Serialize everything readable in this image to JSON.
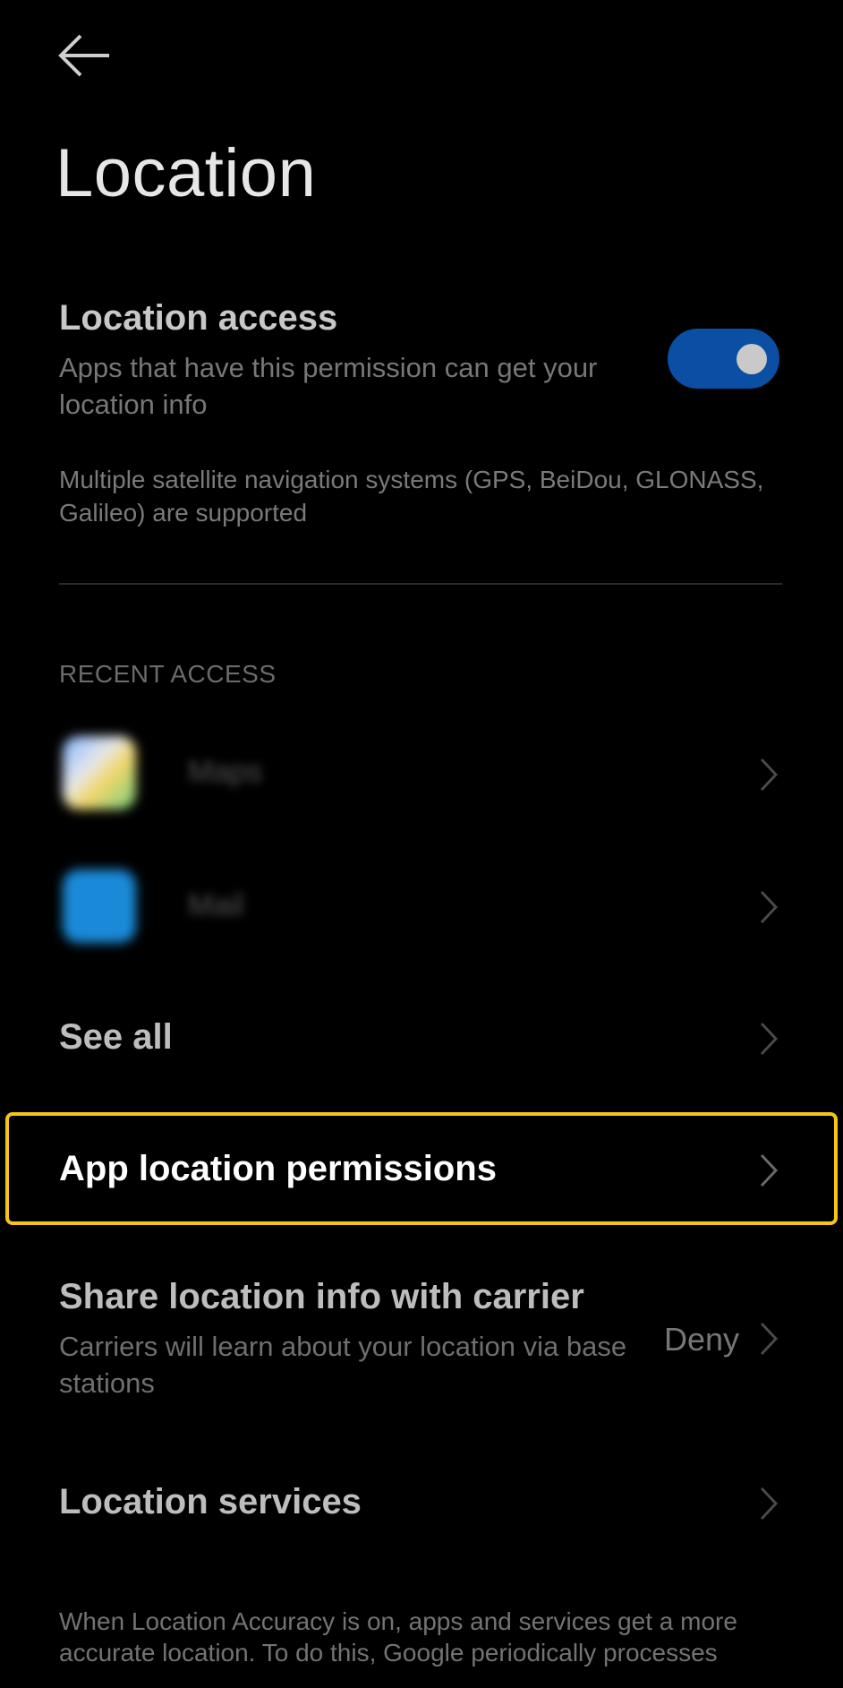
{
  "header": {
    "title": "Location"
  },
  "location_access": {
    "title": "Location access",
    "description": "Apps that have this permission can get your location info",
    "enabled": true,
    "gnss_note": "Multiple satellite navigation systems (GPS, BeiDou, GLONASS, Galileo) are supported"
  },
  "recent_access": {
    "heading": "RECENT ACCESS",
    "apps": [
      {
        "name": "Maps",
        "icon": "maps-app-icon"
      },
      {
        "name": "Mail",
        "icon": "mail-app-icon"
      }
    ]
  },
  "menu": {
    "see_all": "See all",
    "app_permissions": "App location permissions",
    "share_carrier": {
      "title": "Share location info with carrier",
      "description": "Carriers will learn about your location via base stations",
      "value": "Deny"
    },
    "location_services": "Location services"
  },
  "footer": {
    "text": "When Location Accuracy is on, apps and services get a more accurate location. To do this, Google periodically processes"
  },
  "colors": {
    "toggle_on": "#0a4fa3",
    "highlight": "#f5c518"
  }
}
